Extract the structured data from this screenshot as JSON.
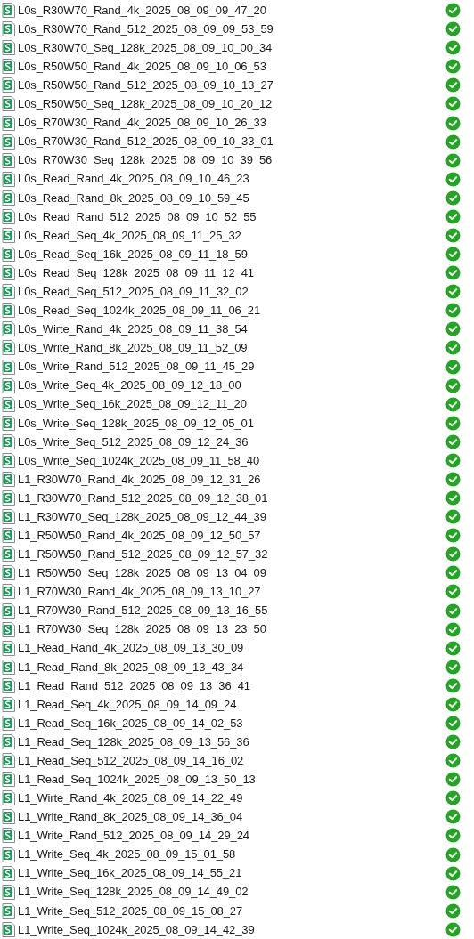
{
  "files": [
    {
      "name": "L0s_R30W70_Rand_4k_2025_08_09_09_47_20",
      "synced": true
    },
    {
      "name": "L0s_R30W70_Rand_512_2025_08_09_09_53_59",
      "synced": true
    },
    {
      "name": "L0s_R30W70_Seq_128k_2025_08_09_10_00_34",
      "synced": true
    },
    {
      "name": "L0s_R50W50_Rand_4k_2025_08_09_10_06_53",
      "synced": true
    },
    {
      "name": "L0s_R50W50_Rand_512_2025_08_09_10_13_27",
      "synced": true
    },
    {
      "name": "L0s_R50W50_Seq_128k_2025_08_09_10_20_12",
      "synced": true
    },
    {
      "name": "L0s_R70W30_Rand_4k_2025_08_09_10_26_33",
      "synced": true
    },
    {
      "name": "L0s_R70W30_Rand_512_2025_08_09_10_33_01",
      "synced": true
    },
    {
      "name": "L0s_R70W30_Seq_128k_2025_08_09_10_39_56",
      "synced": true
    },
    {
      "name": "L0s_Read_Rand_4k_2025_08_09_10_46_23",
      "synced": true
    },
    {
      "name": "L0s_Read_Rand_8k_2025_08_09_10_59_45",
      "synced": true
    },
    {
      "name": "L0s_Read_Rand_512_2025_08_09_10_52_55",
      "synced": true
    },
    {
      "name": "L0s_Read_Seq_4k_2025_08_09_11_25_32",
      "synced": true
    },
    {
      "name": "L0s_Read_Seq_16k_2025_08_09_11_18_59",
      "synced": true
    },
    {
      "name": "L0s_Read_Seq_128k_2025_08_09_11_12_41",
      "synced": true
    },
    {
      "name": "L0s_Read_Seq_512_2025_08_09_11_32_02",
      "synced": true
    },
    {
      "name": "L0s_Read_Seq_1024k_2025_08_09_11_06_21",
      "synced": true
    },
    {
      "name": "L0s_Wirte_Rand_4k_2025_08_09_11_38_54",
      "synced": true
    },
    {
      "name": "L0s_Write_Rand_8k_2025_08_09_11_52_09",
      "synced": true
    },
    {
      "name": "L0s_Write_Rand_512_2025_08_09_11_45_29",
      "synced": true
    },
    {
      "name": "L0s_Write_Seq_4k_2025_08_09_12_18_00",
      "synced": true
    },
    {
      "name": "L0s_Write_Seq_16k_2025_08_09_12_11_20",
      "synced": true
    },
    {
      "name": "L0s_Write_Seq_128k_2025_08_09_12_05_01",
      "synced": true
    },
    {
      "name": "L0s_Write_Seq_512_2025_08_09_12_24_36",
      "synced": true
    },
    {
      "name": "L0s_Write_Seq_1024k_2025_08_09_11_58_40",
      "synced": true
    },
    {
      "name": "L1_R30W70_Rand_4k_2025_08_09_12_31_26",
      "synced": true
    },
    {
      "name": "L1_R30W70_Rand_512_2025_08_09_12_38_01",
      "synced": true
    },
    {
      "name": "L1_R30W70_Seq_128k_2025_08_09_12_44_39",
      "synced": true
    },
    {
      "name": "L1_R50W50_Rand_4k_2025_08_09_12_50_57",
      "synced": true
    },
    {
      "name": "L1_R50W50_Rand_512_2025_08_09_12_57_32",
      "synced": true
    },
    {
      "name": "L1_R50W50_Seq_128k_2025_08_09_13_04_09",
      "synced": true
    },
    {
      "name": "L1_R70W30_Rand_4k_2025_08_09_13_10_27",
      "synced": true
    },
    {
      "name": "L1_R70W30_Rand_512_2025_08_09_13_16_55",
      "synced": true
    },
    {
      "name": "L1_R70W30_Seq_128k_2025_08_09_13_23_50",
      "synced": true
    },
    {
      "name": "L1_Read_Rand_4k_2025_08_09_13_30_09",
      "synced": true
    },
    {
      "name": "L1_Read_Rand_8k_2025_08_09_13_43_34",
      "synced": true
    },
    {
      "name": "L1_Read_Rand_512_2025_08_09_13_36_41",
      "synced": true
    },
    {
      "name": "L1_Read_Seq_4k_2025_08_09_14_09_24",
      "synced": true
    },
    {
      "name": "L1_Read_Seq_16k_2025_08_09_14_02_53",
      "synced": true
    },
    {
      "name": "L1_Read_Seq_128k_2025_08_09_13_56_36",
      "synced": true
    },
    {
      "name": "L1_Read_Seq_512_2025_08_09_14_16_02",
      "synced": true
    },
    {
      "name": "L1_Read_Seq_1024k_2025_08_09_13_50_13",
      "synced": true
    },
    {
      "name": "L1_Wirte_Rand_4k_2025_08_09_14_22_49",
      "synced": true
    },
    {
      "name": "L1_Write_Rand_8k_2025_08_09_14_36_04",
      "synced": true
    },
    {
      "name": "L1_Write_Rand_512_2025_08_09_14_29_24",
      "synced": true
    },
    {
      "name": "L1_Write_Seq_4k_2025_08_09_15_01_58",
      "synced": true
    },
    {
      "name": "L1_Write_Seq_16k_2025_08_09_14_55_21",
      "synced": true
    },
    {
      "name": "L1_Write_Seq_128k_2025_08_09_14_49_02",
      "synced": true
    },
    {
      "name": "L1_Write_Seq_512_2025_08_09_15_08_27",
      "synced": true
    },
    {
      "name": "L1_Write_Seq_1024k_2025_08_09_14_42_39",
      "synced": true
    }
  ]
}
